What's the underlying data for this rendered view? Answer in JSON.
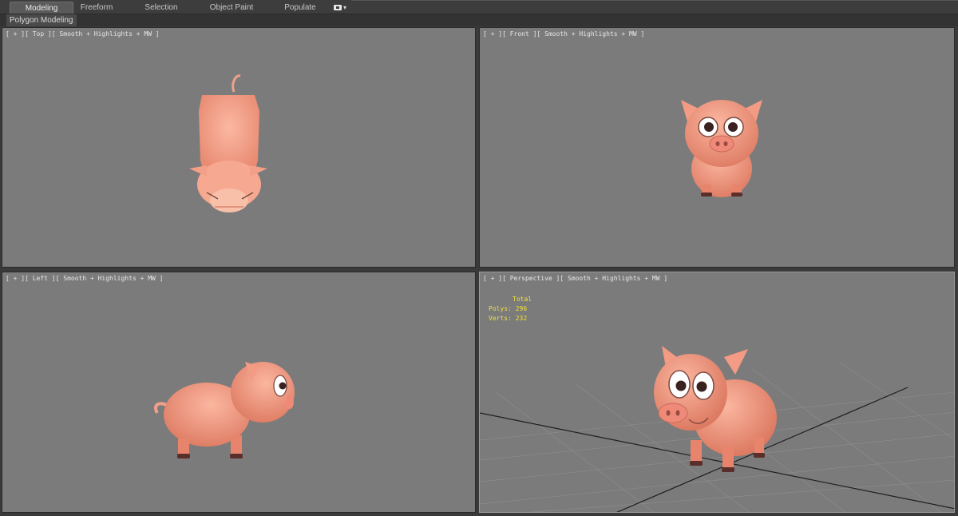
{
  "ribbon": {
    "tabs": [
      {
        "label": "Modeling",
        "active": true
      },
      {
        "label": "Freeform",
        "active": false
      },
      {
        "label": "Selection",
        "active": false
      },
      {
        "label": "Object Paint",
        "active": false
      },
      {
        "label": "Populate",
        "active": false
      }
    ],
    "toggle_glyph": "▾"
  },
  "subbar": {
    "label": "Polygon Modeling"
  },
  "viewports": {
    "top": {
      "label": "[ + ][ Top ][ Smooth + Highlights + MW ]"
    },
    "front": {
      "label": "[ + ][ Front ][ Smooth + Highlights + MW ]"
    },
    "left": {
      "label": "[ + ][ Left ][ Smooth + Highlights + MW ]"
    },
    "perspective": {
      "label": "[ + ][ Perspective ][ Smooth + Highlights + MW ]",
      "stats": {
        "header": "Total",
        "polys_label": "Polys:",
        "polys": "296",
        "verts_label": "Verts:",
        "verts": "232"
      }
    }
  },
  "colors": {
    "viewport_bg": "#7b7b7b",
    "pig_skin": "#f4a088",
    "pig_shadow": "#d9755f",
    "hoof": "#5a2e2a",
    "stats_text": "#f0e040"
  }
}
